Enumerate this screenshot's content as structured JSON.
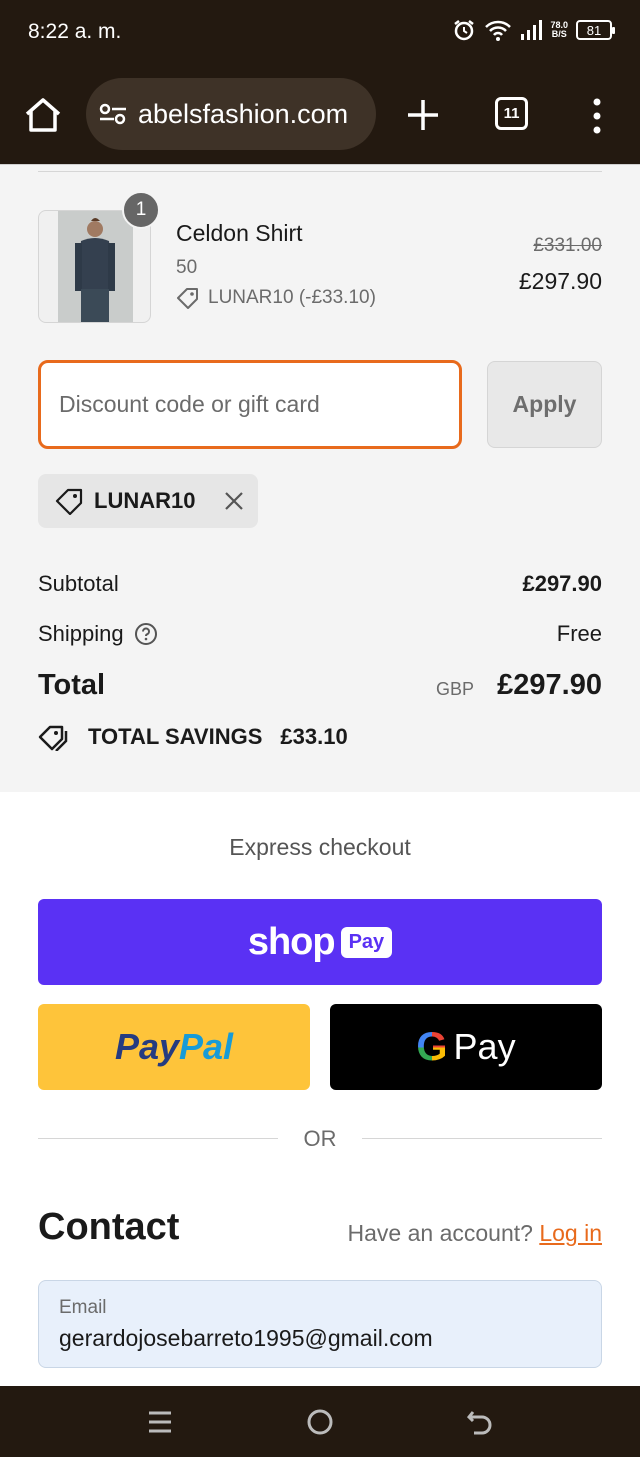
{
  "status_bar": {
    "time": "8:22 a. m.",
    "net_speed_value": "78.0",
    "net_speed_unit": "B/S",
    "battery": "81"
  },
  "browser": {
    "url": "abelsfashion.com",
    "tab_count": "11"
  },
  "order_summary": {
    "item": {
      "name": "Celdon Shirt",
      "variant": "50",
      "discount_note": "LUNAR10 (-£33.10)",
      "quantity": "1",
      "price_original": "£331.00",
      "price_final": "£297.90"
    },
    "discount_field": {
      "placeholder": "Discount code or gift card",
      "apply_label": "Apply"
    },
    "applied_code": "LUNAR10",
    "subtotal_label": "Subtotal",
    "subtotal_value": "£297.90",
    "shipping_label": "Shipping",
    "shipping_value": "Free",
    "total_label": "Total",
    "total_currency": "GBP",
    "total_value": "£297.90",
    "savings_label": "TOTAL SAVINGS",
    "savings_value": "£33.10"
  },
  "express_checkout": {
    "title": "Express checkout",
    "shop_word": "shop",
    "shop_pay_word": "Pay",
    "paypal_a": "Pay",
    "paypal_b": "Pal",
    "gpay_g": "G",
    "gpay_word": "Pay",
    "or_label": "OR"
  },
  "contact": {
    "title": "Contact",
    "account_prompt": "Have an account?",
    "login_label": "Log in",
    "email_label": "Email",
    "email_value": "gerardojosebarreto1995@gmail.com"
  },
  "colors": {
    "accent_orange": "#e86a1c",
    "shop_pay_purple": "#5a31f4",
    "paypal_yellow": "#fec43a",
    "system_bar": "#231910"
  },
  "icons": [
    "alarm-icon",
    "wifi-icon",
    "signal-icon",
    "battery-icon",
    "home-icon",
    "site-settings-icon",
    "new-tab-icon",
    "tab-switcher-icon",
    "more-menu-icon",
    "tag-icon",
    "close-icon",
    "help-icon",
    "savings-tag-icon",
    "recents-icon",
    "nav-home-icon",
    "back-icon"
  ]
}
